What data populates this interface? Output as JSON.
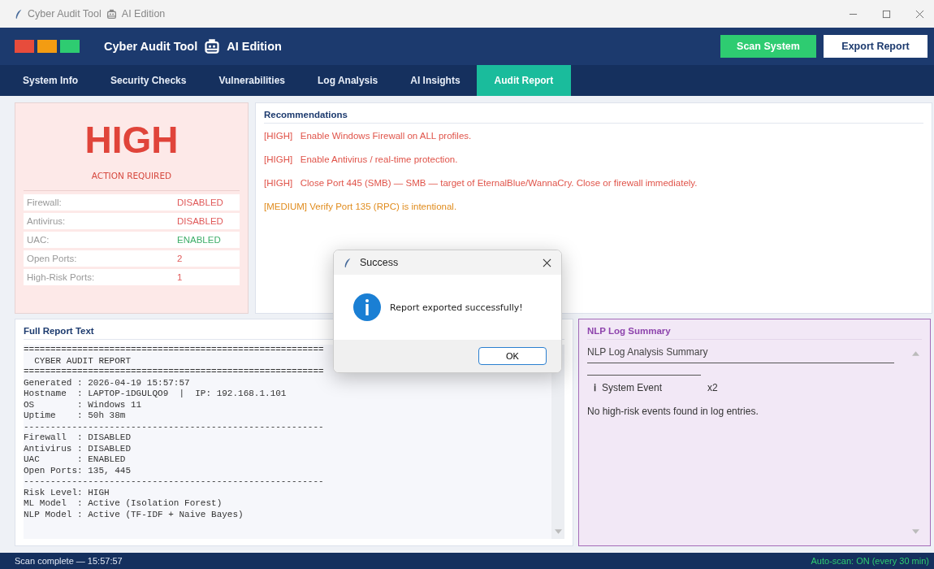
{
  "window": {
    "title_app": "Cyber Audit Tool",
    "title_edition": "AI Edition"
  },
  "header": {
    "title_app": "Cyber Audit Tool",
    "title_edition": "AI Edition",
    "lights": [
      {
        "color": "#e74c3c"
      },
      {
        "color": "#f39c12"
      },
      {
        "color": "#2ecc71"
      }
    ],
    "buttons": [
      {
        "label": "Scan System",
        "kind": "primary"
      },
      {
        "label": "Export Report",
        "kind": "secondary"
      }
    ]
  },
  "tabs": [
    {
      "label": "System Info",
      "selected": false
    },
    {
      "label": "Security Checks",
      "selected": false
    },
    {
      "label": "Vulnerabilities",
      "selected": false
    },
    {
      "label": "Log Analysis",
      "selected": false
    },
    {
      "label": "AI Insights",
      "selected": false
    },
    {
      "label": "Audit Report",
      "selected": true
    }
  ],
  "risk": {
    "level": "HIGH",
    "note": "ACTION REQUIRED",
    "rows": [
      {
        "label": "Firewall:",
        "value": "DISABLED",
        "kind": "alert"
      },
      {
        "label": "Antivirus:",
        "value": "DISABLED",
        "kind": "alert"
      },
      {
        "label": "UAC:",
        "value": "ENABLED",
        "kind": "ok"
      },
      {
        "label": "Open Ports:",
        "value": "2",
        "kind": "alert"
      },
      {
        "label": "High-Risk Ports:",
        "value": "1",
        "kind": "alert"
      }
    ]
  },
  "recommendations": {
    "title": "Recommendations",
    "items": [
      {
        "kind": "high",
        "text": "[HIGH]   Enable Windows Firewall on ALL profiles."
      },
      {
        "kind": "high",
        "text": "[HIGH]   Enable Antivirus / real-time protection."
      },
      {
        "kind": "high",
        "text": "[HIGH]   Close Port 445 (SMB) — SMB — target of EternalBlue/WannaCry. Close or firewall immediately."
      },
      {
        "kind": "medium",
        "text": "[MEDIUM] Verify Port 135 (RPC) is intentional."
      }
    ]
  },
  "report": {
    "title": "Full Report Text",
    "lines": [
      "========================================================",
      "  CYBER AUDIT REPORT",
      "========================================================",
      "Generated : 2026-04-19 15:57:57",
      "Hostname  : LAPTOP-1DGULQO9  |  IP: 192.168.1.101",
      "OS        : Windows 11",
      "Uptime    : 50h 38m",
      "--------------------------------------------------------",
      "Firewall  : DISABLED",
      "Antivirus : DISABLED",
      "UAC       : ENABLED",
      "Open Ports: 135, 445",
      "--------------------------------------------------------",
      "Risk Level: HIGH",
      "ML Model  : Active (Isolation Forest)",
      "NLP Model : Active (TF-IDF + Naive Bayes)"
    ]
  },
  "nlp": {
    "title": "NLP Log Summary",
    "heading": "NLP Log Analysis Summary",
    "events": [
      {
        "icon": "ℹ",
        "label": "System Event",
        "count": "x2"
      }
    ],
    "note": "No high-risk events found in log entries."
  },
  "dialog": {
    "title": "Success",
    "message": "Report exported successfully!",
    "button": "OK"
  },
  "status_bar": {
    "left": "Scan complete — 15:57:57",
    "right": "Auto-scan: ON (every 30 min)"
  }
}
